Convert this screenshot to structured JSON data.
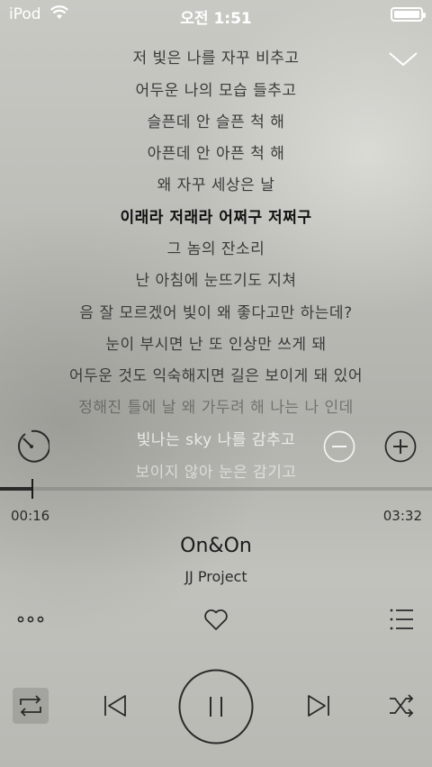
{
  "status_bar": {
    "carrier": "iPod",
    "time": "오전 1:51",
    "battery_level": 1.0,
    "wifi_icon": "wifi-icon",
    "battery_icon": "battery-icon"
  },
  "lyrics": {
    "lines": [
      "저 빛은 나를 자꾸 비추고",
      "어두운 나의 모습 들추고",
      "슬픈데 안 슬픈 척 해",
      "아픈데 안 아픈 척 해",
      "왜 자꾸 세상은 날",
      "이래라 저래라 어쩌구 저쩌구",
      "그 놈의 잔소리",
      "난 아침에 눈뜨기도 지쳐",
      "음 잘 모르겠어 빛이 왜 좋다고만 하는데?",
      "눈이 부시면 난 또 인상만 쓰게 돼",
      "어두운 것도 익숙해지면 길은 보이게 돼 있어",
      "정해진 틀에 날 왜 가두려 해 나는 나 인데",
      "빛나는 sky 나를 감추고",
      "보이지 않아 눈은 감기고"
    ],
    "current_index": 5
  },
  "player": {
    "elapsed": "00:16",
    "duration": "03:32",
    "progress": 0.0755,
    "title": "On&On",
    "artist": "JJ Project"
  },
  "colors": {
    "accent": "#1a1a1a",
    "track": "#8a8a86"
  }
}
